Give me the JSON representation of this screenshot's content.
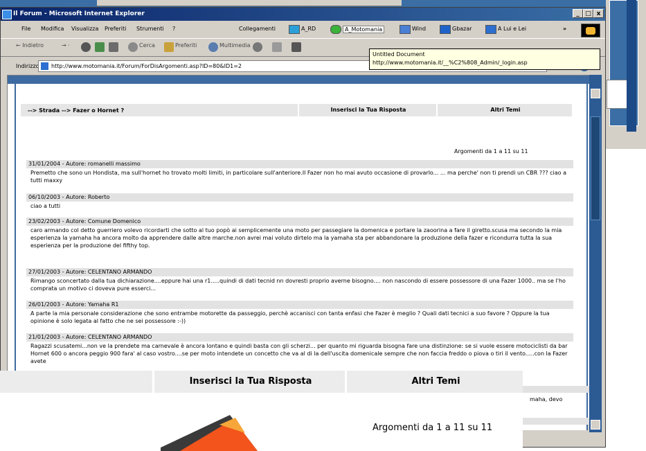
{
  "window": {
    "title": "Il Forum - Microsoft Internet Explorer",
    "controls": [
      "_",
      "□",
      "x"
    ]
  },
  "menu": [
    "File",
    "Modifica",
    "Visualizza",
    "Preferiti",
    "Strumenti",
    "?"
  ],
  "links": {
    "label": "Collegamenti",
    "items": [
      "A_RD",
      "A_Motomania",
      "Wind",
      "Gbazar",
      "A Lui e Lei"
    ]
  },
  "toolbar": {
    "back": "Indietro",
    "search": "Cerca",
    "favorites": "Preferiti",
    "multimedia": "Multimedia"
  },
  "address": {
    "label": "Indirizzo",
    "url": "http://www.motomania.it/Forum/ForDisArgomenti.asp?ID=80&ID1=2"
  },
  "tooltip": {
    "line1": "Untitled Document",
    "line2": "http://www.motomania.it/__%C2%808_Admin/_login.asp"
  },
  "forum": {
    "breadcrumb": "--> Strada --> Fazer o Hornet ?",
    "reply": "Inserisci la Tua Risposta",
    "other": "Altri Temi",
    "count": "Argomenti da 1 a 11 su 11",
    "posts": [
      {
        "head": "31/01/2004 - Autore: romanelli massimo",
        "body": "Premetto che sono un Hondista, ma sull'hornet ho trovato molti limiti, in particolare sull'anteriore.Il Fazer non ho mai avuto occasione di provarlo... ... ma perche' non ti prendi un CBR ??? ciao a tutti maxxy"
      },
      {
        "head": "06/10/2003 - Autore: Roberto",
        "body": "ciao a tutti"
      },
      {
        "head": "23/02/2003 - Autore: Comune Domenico",
        "body": "caro armando col detto guerriero volevo ricordarti che sotto al tuo popò ai semplicemente una moto per passegiare la domenica e portare la zaoorina a fare il giretto.scusa ma secondo la mia esperienza la yamaha ha ancora molto da apprendere dalle altre marche.non avrei mai voluto dirtelo ma la yamaha sta per abbandonare la produzione della fazer e ricondurra tutta la sua esperienza per la produzione del fifthy top."
      },
      {
        "head": "27/01/2003 - Autore: CELENTANO ARMANDO",
        "body": "Rimango sconcertato dalla tua dichiarazione....eppure hai una r1.....quindi di dati tecnid nn dovresti proprio averne bisogno.... non nascondo di essere possessore di una Fazer 1000.. ma se l'ho comprata un motivo ci doveva pure esserci..."
      },
      {
        "head": "26/01/2003 - Autore: Yamaha R1",
        "body": "A parte la mia personale considerazione che sono entrambe motorette da passeggio, perchè accanisci con tanta enfasi che Fazer è meglio ? Quali dati tecnici a suo favore ? Oppure la tua opinione è solo legata al fatto che ne sei possessore :-))"
      },
      {
        "head": "21/01/2003 - Autore: CELENTANO ARMANDO",
        "body": "Ragazzi scusatemi...non ve la prendete ma carnevale è ancora lontano e quindi basta con gli scherzi... per quanto mi riguarda bisogna fare una distinzione: se si vuole essere motociclisti da bar Hornet 600 o ancora peggio 900 fara' al caso vostro....se per moto intendete un concetto che va al di la dell'uscita domenicale sempre che non faccia freddo o piova o tiri il vento.....con la Fazer avete"
      }
    ],
    "partial_tail": "maha, devo"
  },
  "zoom": {
    "reply": "Inserisci la Tua Risposta",
    "other": "Altri Temi",
    "count": "Argomenti da 1 a 11 su 11"
  }
}
